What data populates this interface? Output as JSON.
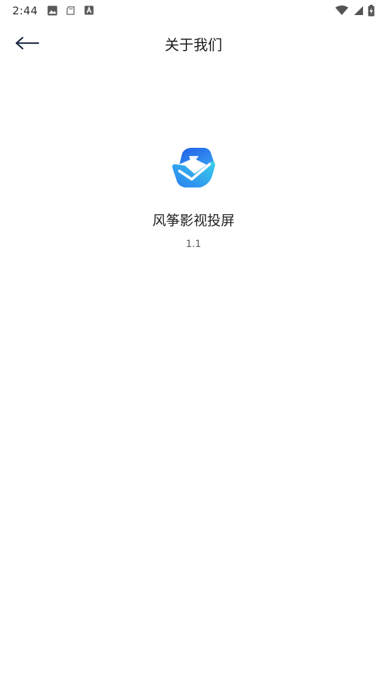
{
  "status_bar": {
    "time": "2:44",
    "left_icons": [
      "image-icon",
      "notification-shape-icon",
      "font-a-icon"
    ],
    "right_icons": [
      "wifi-icon",
      "cell-signal-icon",
      "battery-charging-icon"
    ]
  },
  "app_bar": {
    "back_icon": "arrow-left-icon",
    "title": "关于我们"
  },
  "about": {
    "logo_icon": "app-logo-icon",
    "app_name": "风筝影视投屏",
    "version": "1.1"
  },
  "colors": {
    "background": "#ffffff",
    "title_text": "#1c1c1c",
    "back_arrow": "#1f2a44",
    "logo_primary": "#2a6df0",
    "logo_secondary": "#2ec4e8"
  }
}
